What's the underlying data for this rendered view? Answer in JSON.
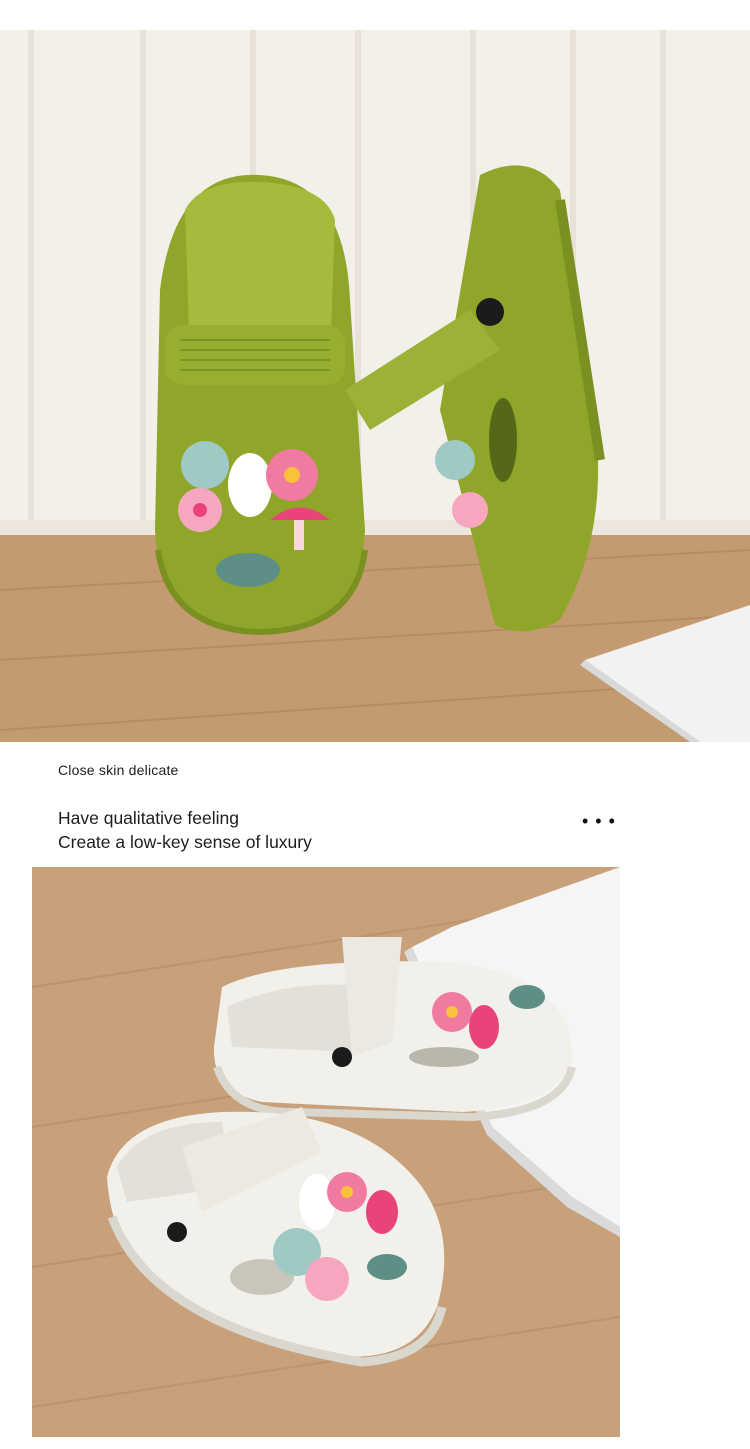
{
  "section": {
    "subtitle": "Close skin delicate",
    "heading_line_1": "Have qualitative feeling",
    "heading_line_2": "Create a low-key sense of luxury",
    "more_indicator": "• • •"
  },
  "images": {
    "top_photo": "green-clogs-product-photo",
    "bottom_photo": "white-clogs-product-photo"
  },
  "colors": {
    "green_clog": "#8fa62a",
    "white_clog": "#f1f0ea",
    "wood_floor": "#c49a70",
    "charm_pink": "#f07aa0",
    "charm_teal": "#5e8f86"
  }
}
